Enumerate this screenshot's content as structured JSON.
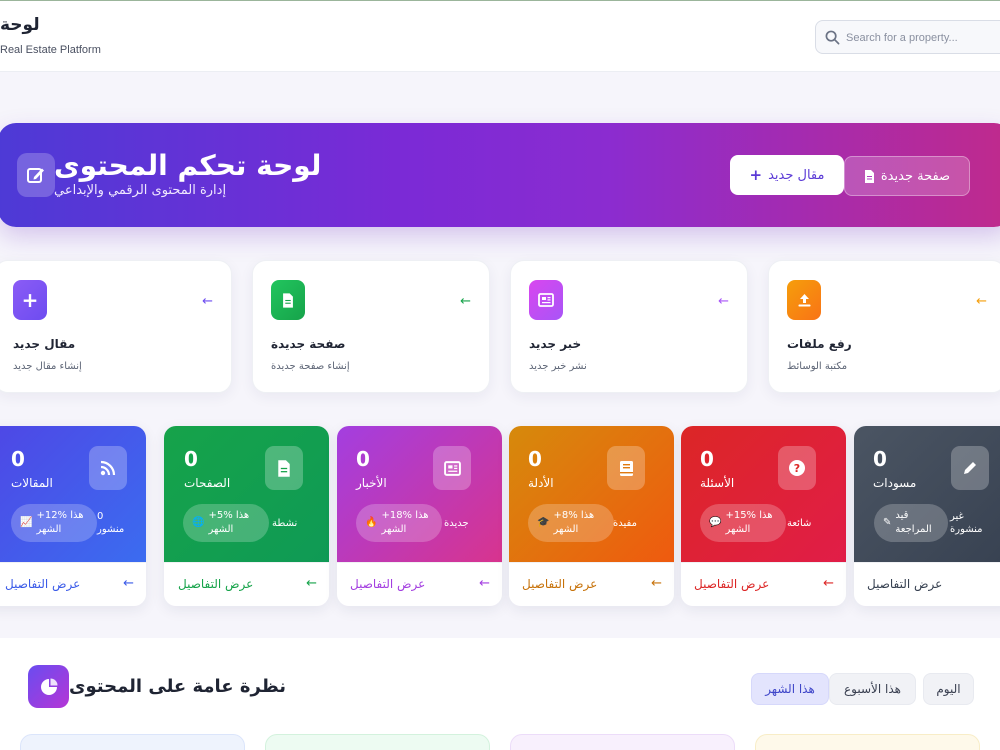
{
  "header": {
    "brand_title": "لوحة",
    "brand_subtitle": "Real Estate Platform",
    "search_placeholder": "Search for a property..."
  },
  "hero": {
    "title": "لوحة تحكم المحتوى",
    "subtitle": "إدارة المحتوى الرقمي والإبداعي",
    "btn_new_article": "مقال جديد",
    "btn_new_page": "صفحة جديدة",
    "gradient": [
      "#4d3ad6",
      "#8b2cd0",
      "#c02a8c"
    ]
  },
  "quick_actions": [
    {
      "title": "مقال جديد",
      "subtitle": "إنشاء مقال جديد",
      "icon": "plus-icon",
      "color": "#7c5cf0"
    },
    {
      "title": "صفحة جديدة",
      "subtitle": "إنشاء صفحة جديدة",
      "icon": "file-icon",
      "color": "#22c063"
    },
    {
      "title": "خبر جديد",
      "subtitle": "نشر خبر جديد",
      "icon": "newspaper-icon",
      "color": "#c845d8"
    },
    {
      "title": "رفع ملفات",
      "subtitle": "مكتبة الوسائط",
      "icon": "upload-icon",
      "color": "#f59e0b"
    }
  ],
  "stats": [
    {
      "value": "0",
      "label": "المقالات",
      "badge_line1": "+12% هذا",
      "badge_line2": "الشهر",
      "side_line1": "0",
      "side_line2": "منشور",
      "details": "عرض التفاصيل",
      "icon": "rss-icon",
      "badge_icon": "chart-icon",
      "color": "#3f56e8"
    },
    {
      "value": "0",
      "label": "الصفحات",
      "badge_line1": "+5% هذا",
      "badge_line2": "الشهر",
      "side_line1": "نشطة",
      "side_line2": "",
      "details": "عرض التفاصيل",
      "icon": "file-icon",
      "badge_icon": "globe-icon",
      "color": "#16a34a"
    },
    {
      "value": "0",
      "label": "الأخبار",
      "badge_line1": "+18% هذا",
      "badge_line2": "الشهر",
      "side_line1": "جديدة",
      "side_line2": "",
      "details": "عرض التفاصيل",
      "icon": "newspaper-icon",
      "badge_icon": "fire-icon",
      "color": "#b23ad6"
    },
    {
      "value": "0",
      "label": "الأدلة",
      "badge_line1": "+8% هذا",
      "badge_line2": "الشهر",
      "side_line1": "مفيدة",
      "side_line2": "",
      "details": "عرض التفاصيل",
      "icon": "book-icon",
      "badge_icon": "graduation-icon",
      "color": "#e07a10"
    },
    {
      "value": "0",
      "label": "الأسئلة",
      "badge_line1": "+15% هذا",
      "badge_line2": "الشهر",
      "side_line1": "شائعة",
      "side_line2": "",
      "details": "عرض التفاصيل",
      "icon": "question-icon",
      "badge_icon": "comments-icon",
      "color": "#dc2626"
    },
    {
      "value": "0",
      "label": "مسودات",
      "badge_line1": "قيد",
      "badge_line2": "المراجعة",
      "side_line1": "غير",
      "side_line2": "منشورة",
      "details": "عرض التفاصيل",
      "icon": "pencil-icon",
      "badge_icon": "edit-icon",
      "color": "#4b5563"
    }
  ],
  "overview": {
    "title": "نظرة عامة على المحتوى",
    "tabs": [
      "هذا الشهر",
      "هذا الأسبوع",
      "اليوم"
    ],
    "active_tab": "هذا الشهر"
  }
}
